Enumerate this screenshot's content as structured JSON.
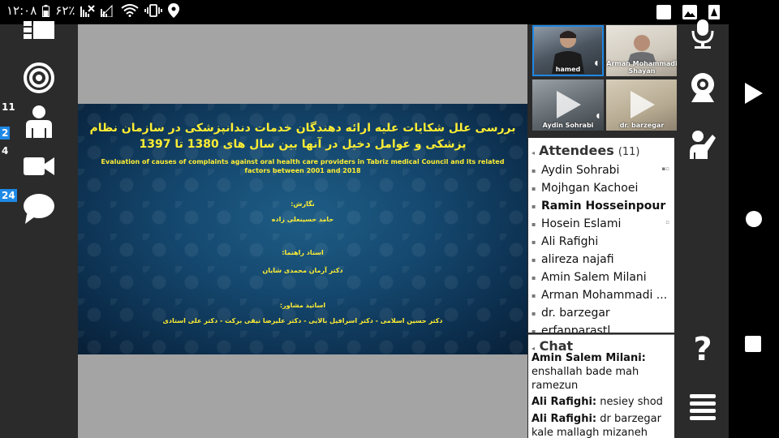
{
  "status": {
    "time": "۱۲:۰۸",
    "battery": "۶۲٪"
  },
  "badges": {
    "participants": "11",
    "b2": "2",
    "cameras": "4",
    "chat": "24"
  },
  "slide": {
    "fa_title": "بررسی علل شکایات علیه ارائه دهندگان  خدمات دندانپزشکی در سازمان نظام پزشکی و عوامل دخیل در آنها بین سال های 1380 تا 1397",
    "en_title": "Evaluation of causes of complaints against oral health care providers in Tabriz medical Council and its related factors between 2001 and 2018",
    "author_label": "نگارش:",
    "author": "حامد حسینعلی زاده",
    "supervisor_label": "استاد راهنما:",
    "supervisor": "دکتر آرمان محمدی شایان",
    "advisors_label": "اساتید مشاور:",
    "advisors": "دکتر حسین اسلامی - دکتر اسرافیل بالایی - دکتر علیرضا نیقی برکت - دکتر علی استادی"
  },
  "videos": [
    {
      "name": "hamed"
    },
    {
      "name": "Arman Mohammadi Shayan"
    },
    {
      "name": "Aydin Sohrabi"
    },
    {
      "name": "dr. barzegar"
    }
  ],
  "attendees": {
    "title": "Attendees",
    "count": "(11)",
    "items": [
      "Aydin Sohrabi",
      "Mojhgan Kachoei",
      "Ramin Hosseinpour",
      "Hosein Eslami",
      "Ali Rafighi",
      "alireza najafi",
      "Amin Salem Milani",
      "Arman Mohammadi ...",
      "dr. barzegar",
      "erfanparastl"
    ]
  },
  "chat": {
    "title": "Chat",
    "messages": [
      {
        "author": "Amin Salem Milani:",
        "text": " enshallah bade mah ramezun"
      },
      {
        "author": "Ali Rafighi:",
        "text": " nesiey shod"
      },
      {
        "author": "Ali Rafighi:",
        "text": " dr barzegar kale mallagh mizaneh"
      }
    ]
  },
  "colors": {
    "slide_text": "#ffee33",
    "badge_blue": "#1e88e5",
    "toolbar_bg": "#2b2b2b",
    "stage_bg": "#a4a4a4"
  }
}
